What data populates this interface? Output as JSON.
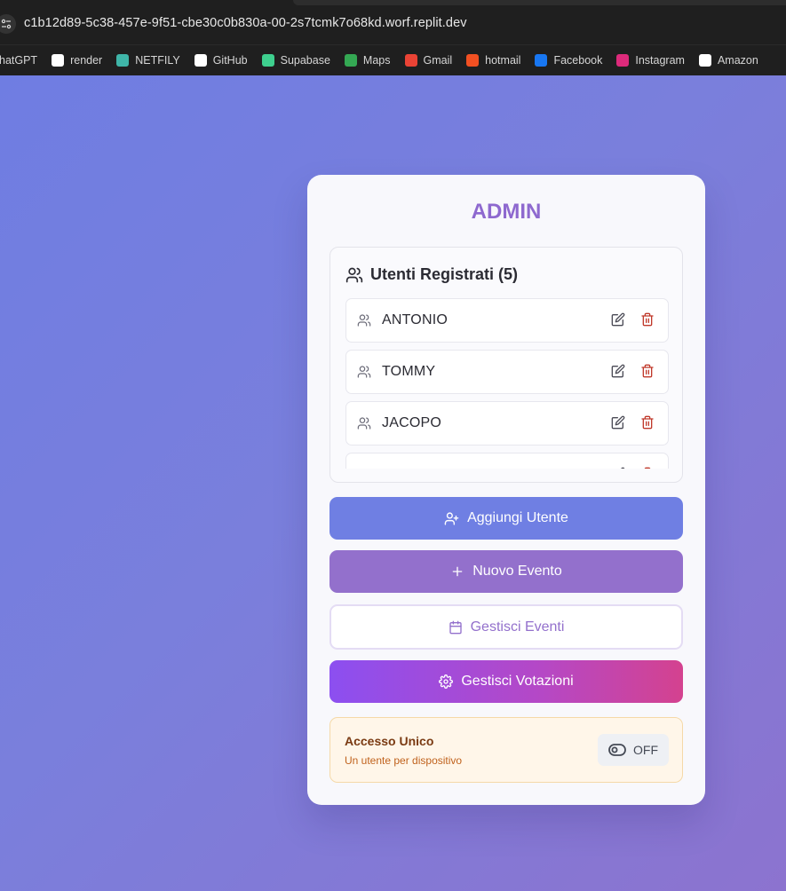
{
  "browser": {
    "url": "c1b12d89-5c38-457e-9f51-cbe30c0b830a-00-2s7tcmk7o68kd.worf.replit.dev",
    "bookmarks": [
      {
        "label": "hatGPT",
        "icon": "chatgpt-icon",
        "color": "#1f1f1f"
      },
      {
        "label": "render",
        "icon": "render-icon",
        "color": "#ffffff"
      },
      {
        "label": "NETFILY",
        "icon": "netlify-icon",
        "color": "#3fb5a8"
      },
      {
        "label": "GitHub",
        "icon": "github-icon",
        "color": "#ffffff"
      },
      {
        "label": "Supabase",
        "icon": "supabase-icon",
        "color": "#3ecf8e"
      },
      {
        "label": "Maps",
        "icon": "maps-icon",
        "color": "#34a853"
      },
      {
        "label": "Gmail",
        "icon": "gmail-icon",
        "color": "#ea4335"
      },
      {
        "label": "hotmail",
        "icon": "hotmail-icon",
        "color": "#f25022"
      },
      {
        "label": "Facebook",
        "icon": "facebook-icon",
        "color": "#1877f2"
      },
      {
        "label": "Instagram",
        "icon": "instagram-icon",
        "color": "#dd2a7b"
      },
      {
        "label": "Amazon",
        "icon": "amazon-icon",
        "color": "#ffffff"
      }
    ]
  },
  "admin": {
    "title": "ADMIN",
    "users_header": "Utenti Registrati (5)",
    "users": [
      {
        "name": "ANTONIO"
      },
      {
        "name": "TOMMY"
      },
      {
        "name": "JACOPO"
      },
      {
        "name": ""
      }
    ],
    "buttons": {
      "add_user": "Aggiungi Utente",
      "new_event": "Nuovo Evento",
      "manage_events": "Gestisci Eventi",
      "manage_votes": "Gestisci Votazioni"
    },
    "access": {
      "title": "Accesso Unico",
      "subtitle": "Un utente per dispositivo",
      "toggle_label": "OFF"
    }
  },
  "colors": {
    "accent": "#8e69cf",
    "add_user_bg": "#6f7fe3",
    "delete_red": "#c0392b"
  }
}
